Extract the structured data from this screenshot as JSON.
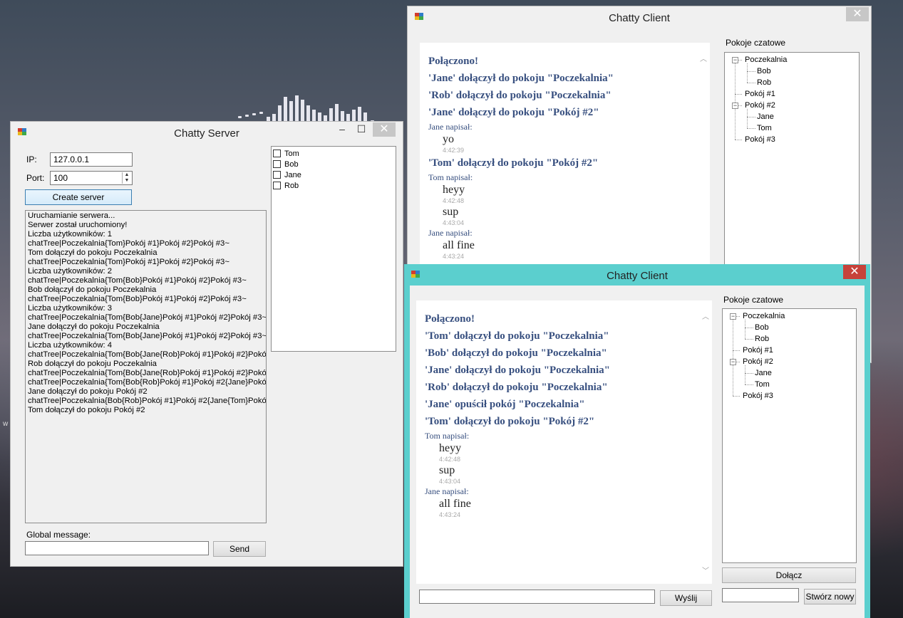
{
  "desktop": {
    "partial_text": "w"
  },
  "server_window": {
    "title": "Chatty Server",
    "ip_label": "IP:",
    "ip_value": "127.0.0.1",
    "port_label": "Port:",
    "port_value": "100",
    "create_button": "Create server",
    "log_lines": [
      "Uruchamianie serwera...",
      "Serwer został uruchomiony!",
      "Liczba użytkowników: 1",
      "chatTree|Poczekalnia{Tom}Pokój #1}Pokój #2}Pokój #3~",
      "Tom dołączył do pokoju Poczekalnia",
      "chatTree|Poczekalnia{Tom}Pokój #1}Pokój #2}Pokój #3~",
      "Liczba użytkowników: 2",
      "chatTree|Poczekalnia{Tom{Bob}Pokój #1}Pokój #2}Pokój #3~",
      "Bob dołączył do pokoju Poczekalnia",
      "chatTree|Poczekalnia{Tom{Bob}Pokój #1}Pokój #2}Pokój #3~",
      "Liczba użytkowników: 3",
      "chatTree|Poczekalnia{Tom{Bob{Jane}Pokój #1}Pokój #2}Pokój #3~",
      "Jane dołączył do pokoju Poczekalnia",
      "chatTree|Poczekalnia{Tom{Bob{Jane}Pokój #1}Pokój #2}Pokój #3~",
      "Liczba użytkowników: 4",
      "chatTree|Poczekalnia{Tom{Bob{Jane{Rob}Pokój #1}Pokój #2}Pokój #",
      "Rob dołączył do pokoju Poczekalnia",
      "chatTree|Poczekalnia{Tom{Bob{Jane{Rob}Pokój #1}Pokój #2}Pokój #",
      "chatTree|Poczekalnia{Tom{Bob{Rob}Pokój #1}Pokój #2{Jane}Pokój #",
      "Jane dołączył do pokoju Pokój #2",
      "chatTree|Poczekalnia{Bob{Rob}Pokój #1}Pokój #2{Jane{Tom}Pokój #",
      "Tom dołączył do pokoju Pokój #2"
    ],
    "users": [
      "Tom",
      "Bob",
      "Jane",
      "Rob"
    ],
    "global_label": "Global message:",
    "global_value": "",
    "send_button": "Send"
  },
  "client_back": {
    "title": "Chatty Client",
    "messages": [
      {
        "kind": "sys",
        "text": "Połączono!"
      },
      {
        "kind": "sys",
        "text": "'Jane' dołączył do pokoju \"Poczekalnia\""
      },
      {
        "kind": "sys",
        "text": "'Rob' dołączył do pokoju \"Poczekalnia\""
      },
      {
        "kind": "sys",
        "text": "'Jane' dołączył do pokoju \"Pokój #2\""
      },
      {
        "kind": "author",
        "text": "Jane napisał:"
      },
      {
        "kind": "msg",
        "text": "yo"
      },
      {
        "kind": "ts",
        "text": "4:42:39"
      },
      {
        "kind": "sys",
        "text": "'Tom' dołączył do pokoju \"Pokój #2\""
      },
      {
        "kind": "author",
        "text": "Tom napisał:"
      },
      {
        "kind": "msg",
        "text": "heyy"
      },
      {
        "kind": "ts",
        "text": "4:42:48"
      },
      {
        "kind": "msg",
        "text": "sup"
      },
      {
        "kind": "ts",
        "text": "4:43:04"
      },
      {
        "kind": "author",
        "text": "Jane napisał:"
      },
      {
        "kind": "msg",
        "text": "all fine"
      },
      {
        "kind": "ts",
        "text": "4:43:24"
      }
    ],
    "rooms_label": "Pokoje czatowe",
    "tree": {
      "waiting": "Poczekalnia",
      "waiting_users": [
        "Bob",
        "Rob"
      ],
      "room1": "Pokój #1",
      "room2": "Pokój #2",
      "room2_users": [
        "Jane",
        "Tom"
      ],
      "room3": "Pokój #3"
    }
  },
  "client_front": {
    "title": "Chatty Client",
    "messages": [
      {
        "kind": "sys",
        "text": "Połączono!"
      },
      {
        "kind": "sys",
        "text": "'Tom' dołączył do pokoju \"Poczekalnia\""
      },
      {
        "kind": "sys",
        "text": "'Bob' dołączył do pokoju \"Poczekalnia\""
      },
      {
        "kind": "sys",
        "text": "'Jane' dołączył do pokoju \"Poczekalnia\""
      },
      {
        "kind": "sys",
        "text": "'Rob' dołączył do pokoju \"Poczekalnia\""
      },
      {
        "kind": "sys",
        "text": "'Jane' opuścił pokój \"Poczekalnia\""
      },
      {
        "kind": "sys",
        "text": "'Tom' dołączył do pokoju \"Pokój #2\""
      },
      {
        "kind": "author",
        "text": "Tom napisał:"
      },
      {
        "kind": "msg",
        "text": "heyy"
      },
      {
        "kind": "ts",
        "text": "4:42:48"
      },
      {
        "kind": "msg",
        "text": "sup"
      },
      {
        "kind": "ts",
        "text": "4:43:04"
      },
      {
        "kind": "author",
        "text": "Jane napisał:"
      },
      {
        "kind": "msg",
        "text": "all fine"
      },
      {
        "kind": "ts",
        "text": "4:43:24"
      }
    ],
    "rooms_label": "Pokoje czatowe",
    "tree": {
      "waiting": "Poczekalnia",
      "waiting_users": [
        "Bob",
        "Rob"
      ],
      "room1": "Pokój #1",
      "room2": "Pokój #2",
      "room2_users": [
        "Jane",
        "Tom"
      ],
      "room3": "Pokój #3"
    },
    "message_value": "",
    "send_button": "Wyślij",
    "join_button": "Dołącz",
    "new_room_value": "",
    "create_room_button": "Stwórz nowy"
  },
  "colors": {
    "active_frame": "#5bcfce",
    "inactive_frame": "#f0f0f0",
    "close_active": "#c7423a",
    "system_message": "#374f7f"
  }
}
